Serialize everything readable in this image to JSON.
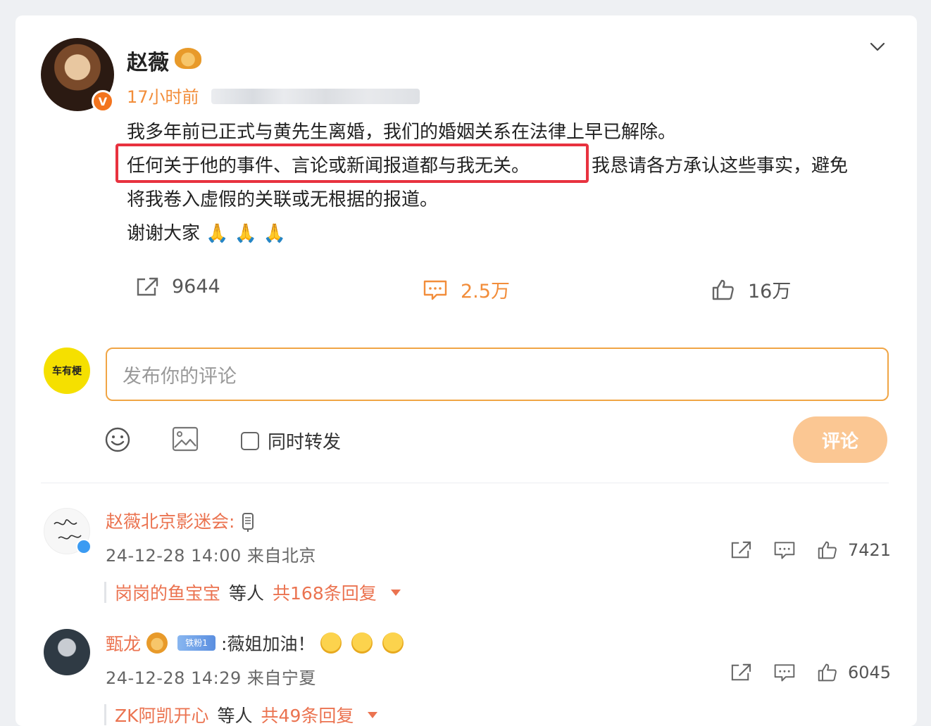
{
  "post": {
    "author": "赵薇",
    "time": "17小时前",
    "verified_mark": "V",
    "lines": [
      "我多年前已正式与黄先生离婚，我们的婚姻关系在法律上早已解除。",
      "任何关于他的事件、言论或新闻报道都与我无关。",
      "我恳请各方承认这些事实，避免",
      "将我卷入虚假的关联或无根据的报道。",
      "谢谢大家"
    ],
    "pray_emoji": "🙏",
    "reposts": "9644",
    "comments": "2.5万",
    "likes": "16万"
  },
  "composer": {
    "avatar_text": "车有梗",
    "placeholder": "发布你的评论",
    "repost_label": "同时转发",
    "submit_label": "评论"
  },
  "comments": [
    {
      "name": "赵薇北京影迷会",
      "suffix": ":",
      "meta": "24-12-28 14:00 来自北京",
      "likes": "7421",
      "reply_user": "岗岗的鱼宝宝",
      "reply_others": "等人",
      "reply_count": "共168条回复"
    },
    {
      "name": "甄龙",
      "fan_badge": "铁粉1",
      "text": ":薇姐加油！",
      "meta": "24-12-28 14:29 来自宁夏",
      "likes": "6045",
      "reply_user": "ZK阿凯开心",
      "reply_others": "等人",
      "reply_count": "共49条回复"
    }
  ],
  "icons": [
    "chevron-down-icon",
    "share-icon",
    "comment-icon",
    "like-icon",
    "emoji-icon",
    "image-icon",
    "microphone-icon"
  ],
  "colors": {
    "accent": "#f28d3a",
    "name": "#eb7350",
    "highlight": "#e8323f",
    "submit": "#fbc793"
  }
}
